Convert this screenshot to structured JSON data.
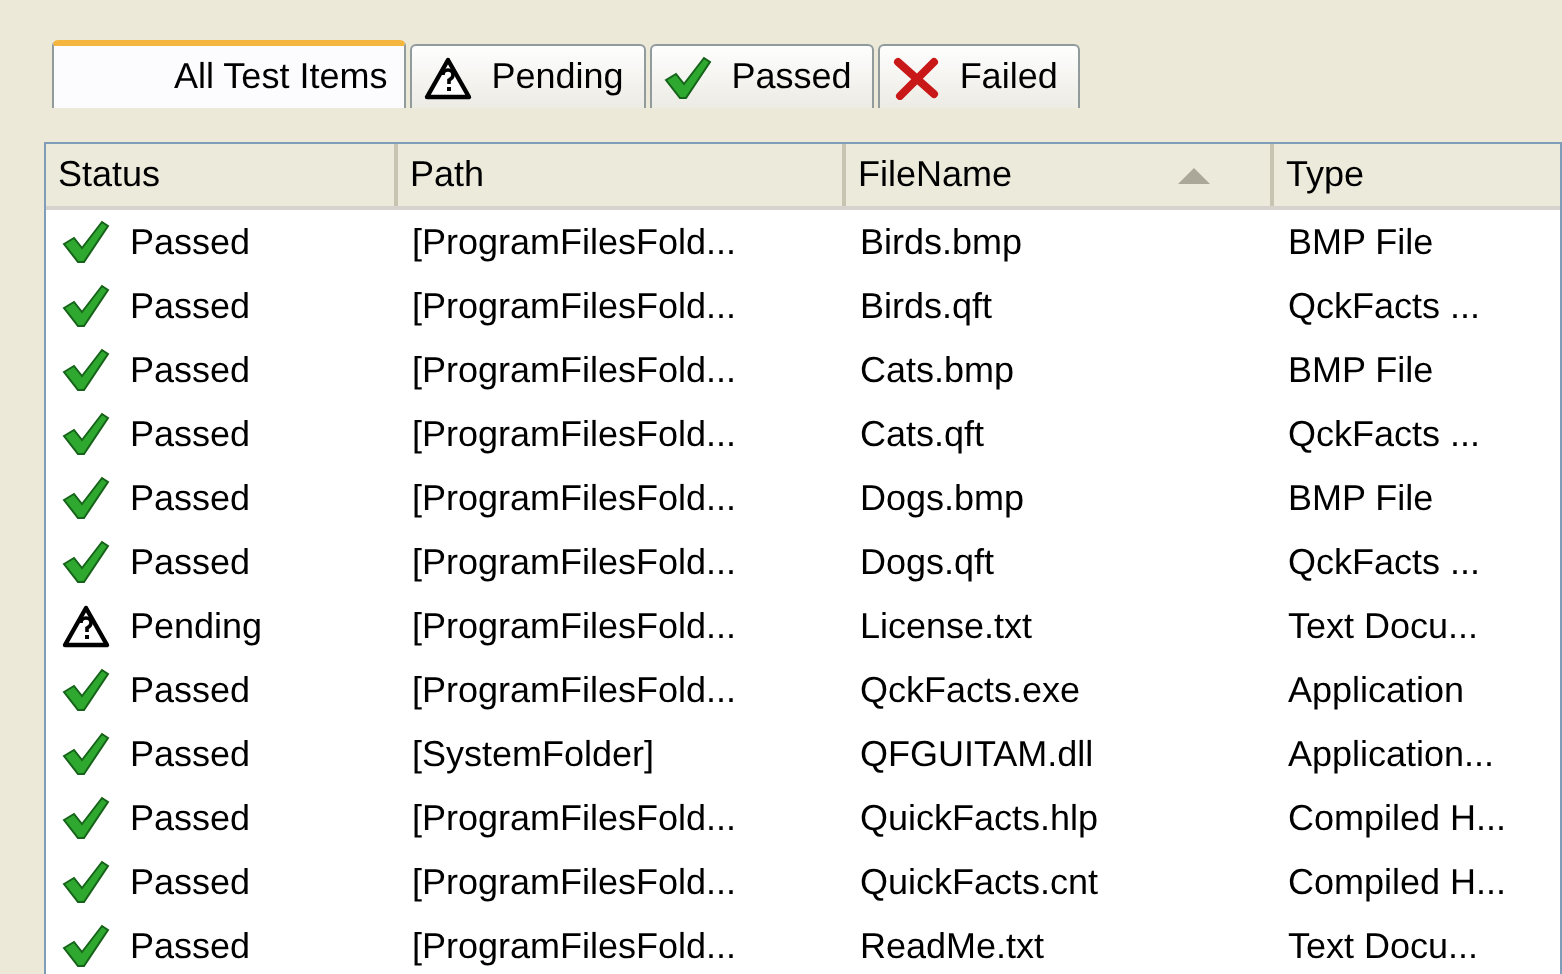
{
  "tabs": [
    {
      "label": "All Test Items",
      "selected": true
    },
    {
      "label": "Pending",
      "kind": "pending",
      "selected": false
    },
    {
      "label": "Passed",
      "kind": "passed",
      "selected": false
    },
    {
      "label": "Failed",
      "kind": "failed",
      "selected": false
    }
  ],
  "table": {
    "columns": [
      {
        "label": "Status",
        "sorted": false
      },
      {
        "label": "Path",
        "sorted": false
      },
      {
        "label": "FileName",
        "sorted": true
      },
      {
        "label": "Type",
        "sorted": false
      }
    ],
    "rows": [
      {
        "status": "Passed",
        "kind": "passed",
        "path": "[ProgramFilesFold...",
        "filename": "Birds.bmp",
        "type": "BMP File"
      },
      {
        "status": "Passed",
        "kind": "passed",
        "path": "[ProgramFilesFold...",
        "filename": "Birds.qft",
        "type": "QckFacts ..."
      },
      {
        "status": "Passed",
        "kind": "passed",
        "path": "[ProgramFilesFold...",
        "filename": "Cats.bmp",
        "type": "BMP File"
      },
      {
        "status": "Passed",
        "kind": "passed",
        "path": "[ProgramFilesFold...",
        "filename": "Cats.qft",
        "type": "QckFacts ..."
      },
      {
        "status": "Passed",
        "kind": "passed",
        "path": "[ProgramFilesFold...",
        "filename": "Dogs.bmp",
        "type": "BMP File"
      },
      {
        "status": "Passed",
        "kind": "passed",
        "path": "[ProgramFilesFold...",
        "filename": "Dogs.qft",
        "type": "QckFacts ..."
      },
      {
        "status": "Pending",
        "kind": "pending",
        "path": "[ProgramFilesFold...",
        "filename": "License.txt",
        "type": "Text Docu..."
      },
      {
        "status": "Passed",
        "kind": "passed",
        "path": "[ProgramFilesFold...",
        "filename": "QckFacts.exe",
        "type": "Application"
      },
      {
        "status": "Passed",
        "kind": "passed",
        "path": "[SystemFolder]",
        "filename": "QFGUITAM.dll",
        "type": "Application..."
      },
      {
        "status": "Passed",
        "kind": "passed",
        "path": "[ProgramFilesFold...",
        "filename": "QuickFacts.hlp",
        "type": "Compiled H..."
      },
      {
        "status": "Passed",
        "kind": "passed",
        "path": "[ProgramFilesFold...",
        "filename": "QuickFacts.cnt",
        "type": "Compiled H..."
      },
      {
        "status": "Passed",
        "kind": "passed",
        "path": "[ProgramFilesFold...",
        "filename": "ReadMe.txt",
        "type": "Text Docu..."
      }
    ]
  }
}
